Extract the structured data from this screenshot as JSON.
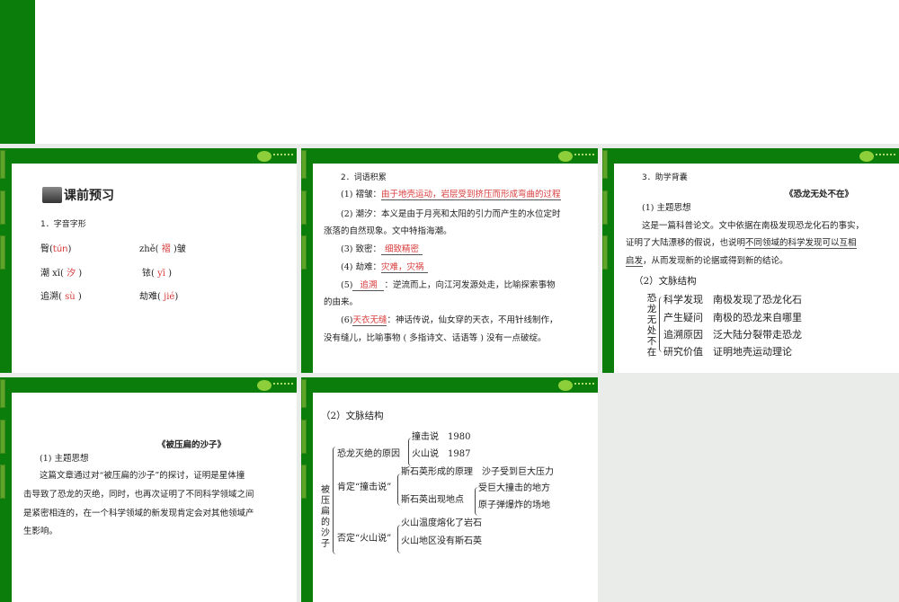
{
  "colors": {
    "frame": "#0a7d0a",
    "tab": "#5ea428",
    "accent_red": "#d93a3a",
    "background": "#e9ece9"
  },
  "slide1": {
    "heading": "课前预习",
    "section": "1．字音字形",
    "items": [
      {
        "word": "臀(",
        "answer": "tún",
        "close": ")"
      },
      {
        "word": "zhě(",
        "answer": "褶",
        "close": ")皱"
      },
      {
        "word": "潮 xī(",
        "answer": "汐",
        "close": ")"
      },
      {
        "word": "铱(",
        "answer": "yī",
        "close": ")"
      },
      {
        "word": "追溯(",
        "answer": "sù",
        "close": ")"
      },
      {
        "word": "劫难(",
        "answer": "jié",
        "close": ")"
      }
    ]
  },
  "slide2": {
    "section": "2．词语积累",
    "l1a": "(1) 褶皱：",
    "l1b": "由于地壳运动，岩层受到挤压而形成弯曲的过程",
    "l2a": "(2) 潮汐：本义是由于月亮和太阳的引力而产生的水位定时",
    "l2b": "涨落的自然现象。文中特指海潮。",
    "l3a": "(3) 致密：",
    "l3b": "细致精密",
    "l4a": "(4) 劫难：",
    "l4b": "灾难，灾祸",
    "l5a": "(5)",
    "l5b": "追溯",
    "l5c": "：逆流而上，向江河发源处走，比喻探索事物",
    "l5d": "的由来。",
    "l6a": "(6)",
    "l6b": "天衣无缝",
    "l6c": "：神话传说，仙女穿的天衣，不用针线制作，",
    "l6d": "没有缝儿，比喻事物 ( 多指诗文、话语等 ) 没有一点破绽。"
  },
  "slide3": {
    "section": "3．助学背囊",
    "title": "《恐龙无处不在》",
    "sub1": "(1) 主题思想",
    "p1": "这是一篇科普论文。文中依据在南极发现恐龙化石的事实，",
    "p2a": "证明了大陆漂移的假说，也说明",
    "p2b": "不同领域的科学发现可以互相",
    "p3a": "启发",
    "p3b": "，从而发现新的论据或得到新的结论。",
    "sub2": "（2）文脉结构",
    "root": "恐龙无处不在",
    "rows": [
      {
        "k": "科学发现",
        "v": "南极发现了恐龙化石"
      },
      {
        "k": "产生疑问",
        "v": "南极的恐龙来自哪里"
      },
      {
        "k": "追溯原因",
        "v": "泛大陆分裂带走恐龙"
      },
      {
        "k": "研究价值",
        "v": "证明地壳运动理论"
      }
    ]
  },
  "slide4": {
    "title": "《被压扁的沙子》",
    "sub1": "(1) 主题思想",
    "p1": "这篇文章通过对“被压扁的沙子”的探讨，证明是星体撞",
    "p2": "击导致了恐龙的灭绝，同时，也再次证明了不同科学领域之间",
    "p3": "是紧密相连的，在一个科学领域的新发现肯定会对其他领域产",
    "p4": "生影响。"
  },
  "slide5": {
    "sub2": "（2）文脉结构",
    "root": "被压扁的沙子",
    "b1": "恐龙灭绝的原因",
    "b1a": "撞击说　1980",
    "b1b": "火山说　1987",
    "b2": "肯定“撞击说”",
    "b2a": "斯石英形成的原理　沙子受到巨大压力",
    "b2b": "斯石英出现地点",
    "b2b1": "受巨大撞击的地方",
    "b2b2": "原子弹爆炸的场地",
    "b3": "否定“火山说”",
    "b3a": "火山温度熔化了岩石",
    "b3b": "火山地区没有斯石英"
  }
}
